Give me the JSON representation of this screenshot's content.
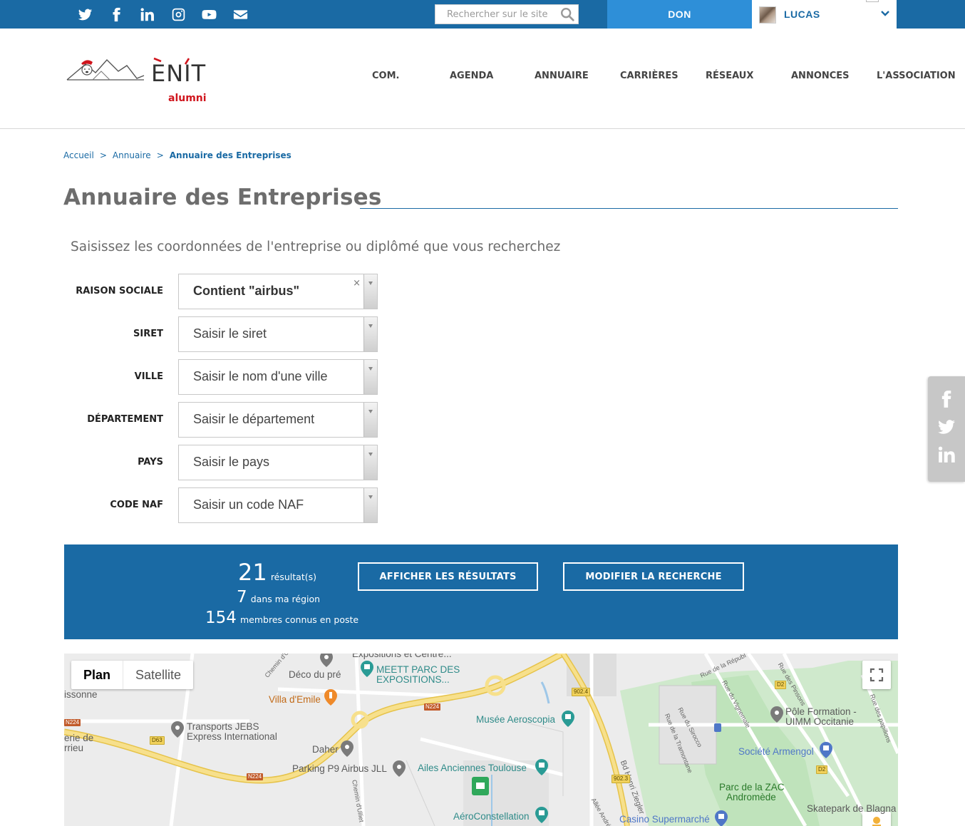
{
  "topbar": {
    "social_icons": [
      "twitter-icon",
      "facebook-icon",
      "linkedin-icon",
      "instagram-icon",
      "youtube-icon",
      "envelope-icon"
    ],
    "search_placeholder": "Rechercher sur le site",
    "don_label": "DON",
    "user_name": "LUCAS",
    "colors": {
      "bar": "#1a6aa4",
      "don": "#2e8fd8"
    }
  },
  "header": {
    "logo_text": "ENIT",
    "logo_sub": "alumni",
    "nav": [
      "COM.",
      "AGENDA",
      "ANNUAIRE",
      "CARRIÈRES",
      "RÉSEAUX",
      "ANNONCES",
      "L'ASSOCIATION"
    ]
  },
  "breadcrumb": {
    "items": [
      "Accueil",
      "Annuaire"
    ],
    "current": "Annuaire des Entreprises",
    "separator": ">"
  },
  "page": {
    "title": "Annuaire des Entreprises",
    "intro": "Saisissez les coordonnées de l'entreprise ou diplômé que vous recherchez"
  },
  "form": {
    "fields": [
      {
        "label": "RAISON SOCIALE",
        "value": "Contient \"airbus\"",
        "clearable": true
      },
      {
        "label": "SIRET",
        "value": "Saisir le siret"
      },
      {
        "label": "VILLE",
        "value": "Saisir le nom d'une ville"
      },
      {
        "label": "DÉPARTEMENT",
        "value": "Saisir le département"
      },
      {
        "label": "PAYS",
        "value": "Saisir le pays"
      },
      {
        "label": "CODE NAF",
        "value": "Saisir un code NAF"
      }
    ],
    "clear_glyph": "×"
  },
  "results": {
    "count": "21",
    "count_label": "résultat(s)",
    "region": "7",
    "region_label": "dans ma région",
    "members": "154",
    "members_label": "membres connus en poste",
    "show_button": "AFFICHER LES RÉSULTATS",
    "modify_button": "MODIFIER LA RECHERCHE"
  },
  "map": {
    "types": [
      "Plan",
      "Satellite"
    ],
    "active_type": "Plan",
    "labels": {
      "expos_top": "Expositions et Centre...",
      "meett": "MEETT PARC DES",
      "meett2": "EXPOSITIONS...",
      "deco": "Déco du pré",
      "villa": "Villa d'Emile",
      "transports": "Transports JEBS",
      "transports2": "Express International",
      "musee": "Musée Aeroscopia",
      "daher": "Daher",
      "parking": "Parking P9 Airbus JLL",
      "ailes": "Ailes Anciennes Toulouse",
      "aeroconst": "AéroConstellation",
      "pole": "Pôle Formation -",
      "pole2": "UIMM Occitanie",
      "armengol": "Société Armengol",
      "zac": "Parc de la ZAC",
      "zac2": "Andromède",
      "skatepark": "Skatepark de Blagna",
      "casino": "Casino Supermarché",
      "henri": "Bd Henri Ziegler",
      "chemin": "Chemin d'Ulliet",
      "chemin2": "Chemin d'Ulliet",
      "buissonne": "issonne",
      "erie": "erie de",
      "arrieu": "rrieu",
      "rue_rep": "Rue de la Républ",
      "rue_pinsons": "Rue des Pinsons",
      "rue_vign": "Rue du Vignemale",
      "rue_sirocco": "Rue du Sirocco",
      "rue_tram": "Rue de la Tramontane",
      "rue_pap": "Rue des papillons",
      "allee": "Allée André T",
      "n224a": "N224",
      "n224b": "N224",
      "n224c": "N224",
      "d63": "D63",
      "r9024": "902.4",
      "r9023": "902.3",
      "d2a": "D2",
      "d2b": "D2"
    }
  }
}
